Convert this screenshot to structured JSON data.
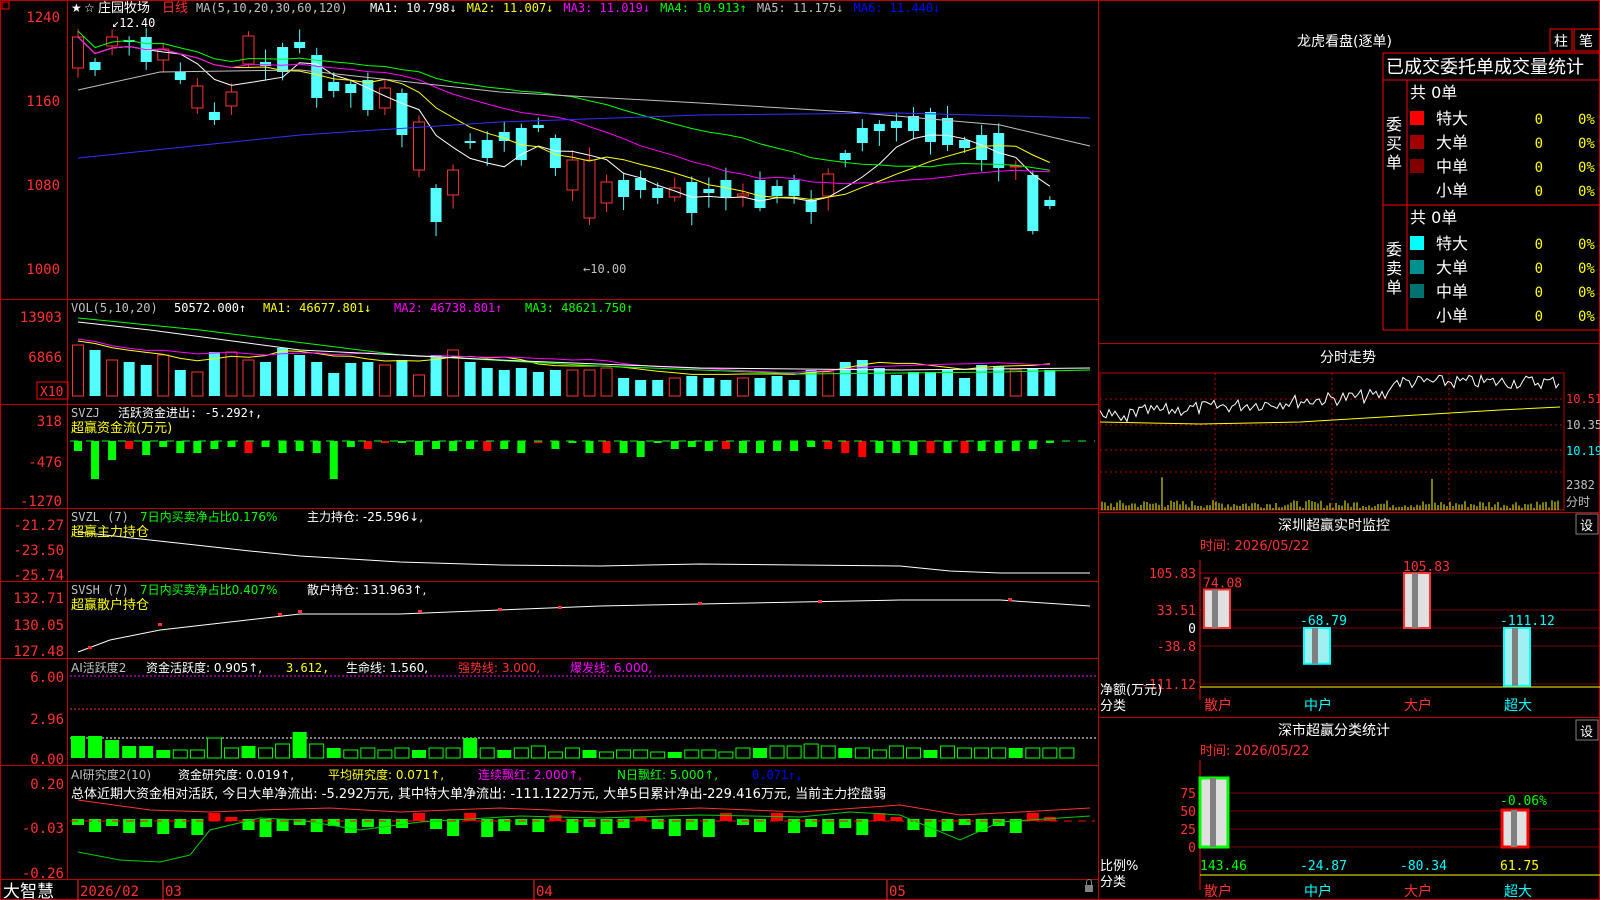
{
  "stock": {
    "name": "庄园牧场",
    "period": "日线",
    "ma_label": "MA(5,10,20,30,60,120)",
    "ma_values": [
      {
        "label": "MA1: 10.798↓",
        "color": "#ffffff"
      },
      {
        "label": "MA2: 11.007↓",
        "color": "#ffff00"
      },
      {
        "label": "MA3: 11.019↓",
        "color": "#ff00ff"
      },
      {
        "label": "MA4: 10.913↑",
        "color": "#00ff00"
      },
      {
        "label": "MA5: 11.175↓",
        "color": "#c0c0c0"
      },
      {
        "label": "MA6: 11.440↓",
        "color": "#0000ff"
      }
    ],
    "high_label": "12.40",
    "low_label": "←10.00",
    "price_axis": [
      "1240",
      "1160",
      "1080",
      "1000"
    ]
  },
  "vol": {
    "title": "VOL(5,10,20)",
    "value": "50572.000↑",
    "ma1": "MA1: 46677.801↓",
    "ma2": "MA2: 46738.801↑",
    "ma3": "MA3: 48621.750↑",
    "axis": [
      "13903",
      "6866"
    ],
    "unit": "X10"
  },
  "svzj": {
    "title": "SVZJ",
    "line1": "活跃资金进出: -5.292↑,",
    "line2": "超赢资金流(万元)",
    "axis": [
      "318",
      "-476",
      "-1270"
    ]
  },
  "svzl": {
    "title": "SVZL (7)",
    "text1": "7日内买卖净占比0.176%",
    "text2": "主力持仓: -25.596↓,",
    "line2": "超赢主力持仓",
    "axis": [
      "-21.27",
      "-23.50",
      "-25.74"
    ]
  },
  "svsh": {
    "title": "SVSH (7)",
    "text1": "7日内买卖净占比0.407%",
    "text2": "散户持仓: 131.963↑,",
    "line2": "超赢散户持仓",
    "axis": [
      "132.71",
      "130.05",
      "127.48"
    ]
  },
  "ai1": {
    "title": "AI活跃度2",
    "t1": "资金活跃度: 0.905↑,",
    "t2": "3.612,",
    "t3": "生命线: 1.560,",
    "t4": "强势线: 3.000,",
    "t5": "爆发线: 6.000,",
    "axis": [
      "6.00",
      "2.96",
      "0.00"
    ]
  },
  "ai2": {
    "title": "AI研究度2(10)",
    "t1": "资金研究度: 0.019↑,",
    "t2": "平均研究度: 0.071↑,",
    "t3": "连续飘红: 2.000↑,",
    "t4": "N日飘红: 5.000↑,",
    "t5": "0.071↑,",
    "summary": "总体近期大资金相对活跃, 今日大单净流出: -5.292万元, 其中特大单净流出: -111.122万元, 大单5日累计净出-229.416万元, 当前主力控盘弱",
    "axis": [
      "0.20",
      "-0.03",
      "-0.26"
    ]
  },
  "xaxis": {
    "logo": "大智慧",
    "labels": [
      "2026/02",
      "03",
      "04",
      "05"
    ]
  },
  "dragon": {
    "title": "龙虎看盘(逐单)",
    "btn_bar": "柱",
    "btn_pen": "笔",
    "header": "已成交委托单成交量统计",
    "buy_label": "委买单",
    "sell_label": "委卖单",
    "buy_total": "共 0单",
    "sell_total": "共 0单",
    "rows": [
      "特大",
      "大单",
      "中单",
      "小单"
    ],
    "buy_colors": [
      "#ff0000",
      "#a00000",
      "#800000",
      "#000000"
    ],
    "sell_colors": [
      "#00ffff",
      "#009090",
      "#007070",
      "#000000"
    ],
    "zero": "0",
    "pct": "0%"
  },
  "intraday": {
    "title": "分时走势",
    "price_labels": [
      "10.51",
      "10.35",
      "10.19"
    ],
    "vol_labels": [
      "2382",
      "分时"
    ]
  },
  "monitor": {
    "title": "深圳超赢实时监控",
    "set": "设",
    "time": "时间: 2026/05/22",
    "axis": [
      "105.83",
      "33.51",
      "0",
      "-38.8",
      "-111.12"
    ],
    "ylabel": "净额(万元)",
    "xlabel": "分类",
    "cats": [
      "散户",
      "中户",
      "大户",
      "超大"
    ],
    "values": [
      "74.08",
      "-68.79",
      "105.83",
      "-111.12"
    ]
  },
  "classify": {
    "title": "深市超赢分类统计",
    "set": "设",
    "time": "时间: 2026/05/22",
    "axis": [
      "75",
      "50",
      "25",
      "0"
    ],
    "ylabel": "比例%",
    "xlabel": "分类",
    "cats": [
      "散户",
      "中户",
      "大户",
      "超大"
    ],
    "values": [
      "143.46",
      "-24.87",
      "-80.34",
      "61.75"
    ],
    "top_label": "-0.06%"
  }
}
